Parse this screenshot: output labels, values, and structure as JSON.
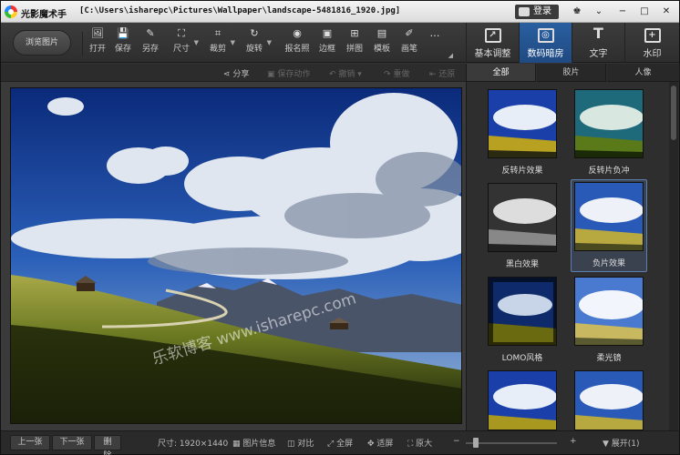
{
  "titlebar": {
    "app_name": "光影魔术手",
    "file_path": "[C:\\Users\\isharepc\\Pictures\\Wallpaper\\landscape-5481816_1920.jpg]",
    "login_label": "登录",
    "window_buttons": [
      "♚",
      "⌄",
      "−",
      "□",
      "✕"
    ]
  },
  "toolbar": {
    "browse_label": "浏览图片",
    "tools": [
      "打开",
      "保存",
      "另存",
      "尺寸",
      "裁剪",
      "旋转",
      "报名照",
      "边框",
      "拼图",
      "模板",
      "画笔",
      "…"
    ],
    "right_tabs": [
      "基本调整",
      "数码暗房",
      "文字",
      "水印"
    ]
  },
  "actions": {
    "share": "分享",
    "save_action": "保存动作",
    "undo": "撤销",
    "redo": "重做",
    "restore": "还原"
  },
  "photo": {
    "watermark": "乐软博客 www.isharepc.com"
  },
  "panel": {
    "filter_tabs": [
      "全部",
      "胶片",
      "人像"
    ],
    "active_tab": "全部",
    "effects": [
      "反转片效果",
      "反转片负冲",
      "黑白效果",
      "负片效果",
      "LOMO风格",
      "柔光镜",
      "",
      ""
    ],
    "selected_effect": "负片效果"
  },
  "statusbar": {
    "prev_label": "上一张",
    "next_label": "下一张",
    "delete_label": "删除",
    "size_text": "尺寸: 1920×1440",
    "info_label": "图片信息",
    "compare_label": "对比",
    "fullscreen_label": "全屏",
    "fit_label": "适屏",
    "actual_label": "原大",
    "zoom_minus": "−",
    "zoom_plus": "+",
    "expand_label": "展开(1)"
  },
  "colors": {
    "accent": "#2a5fa0",
    "selected_border": "#5a7fb0"
  }
}
